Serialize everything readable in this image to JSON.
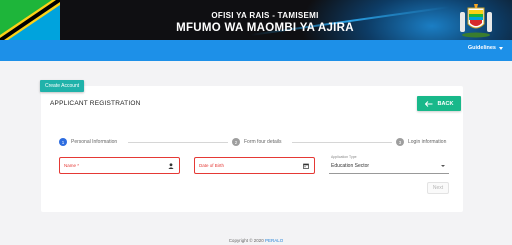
{
  "banner": {
    "line1": "OFISI YA RAIS - TAMISEMI",
    "line2": "MFUMO WA MAOMBI YA AJIRA"
  },
  "nav": {
    "guidelines": "Guidelines"
  },
  "card": {
    "tag": "Create Account",
    "title": "APPLICANT REGISTRATION",
    "back": "BACK"
  },
  "steps": [
    {
      "num": "1",
      "label": "Personal Information",
      "state": "active"
    },
    {
      "num": "2",
      "label": "Form four details",
      "state": "idle"
    },
    {
      "num": "3",
      "label": "Login information",
      "state": "idle"
    }
  ],
  "form": {
    "name_placeholder": "Name *",
    "dob_placeholder": "Date of Birth",
    "type_label": "Application Type",
    "type_value": "Education Sector",
    "next": "Next"
  },
  "footer": {
    "copyright": "Copyright © 2020 ",
    "brand": "PERALO"
  },
  "colors": {
    "nav": "#1d90e8",
    "tag": "#20b2aa",
    "back": "#18b88a",
    "error": "#e53935",
    "step_active": "#2d6cdf"
  }
}
